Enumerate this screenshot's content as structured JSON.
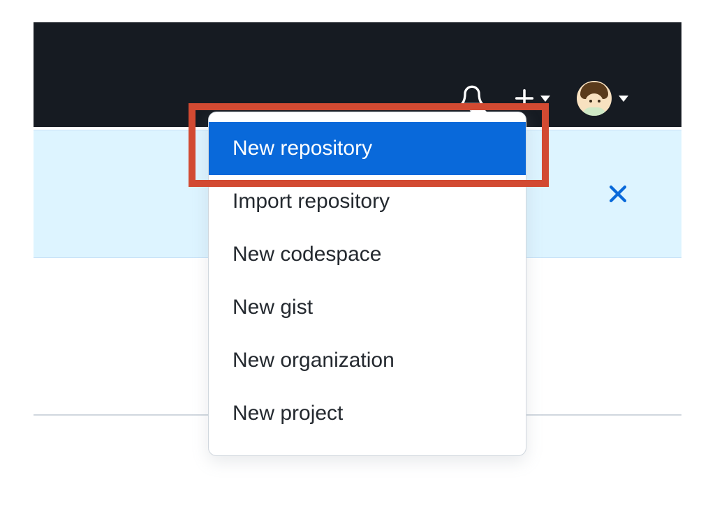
{
  "header": {
    "notification_label": "Notifications",
    "create_label": "Create new…",
    "user_label": "User menu"
  },
  "dropdown": {
    "items": [
      {
        "label": "New repository",
        "active": true
      },
      {
        "label": "Import repository",
        "active": false
      },
      {
        "label": "New codespace",
        "active": false
      },
      {
        "label": "New gist",
        "active": false
      },
      {
        "label": "New organization",
        "active": false
      },
      {
        "label": "New project",
        "active": false
      }
    ]
  },
  "banner": {
    "dismiss_label": "Dismiss"
  },
  "colors": {
    "highlight": "#d24a32",
    "accent": "#0969da",
    "header_bg": "#161b22",
    "banner_bg": "#ddf4ff"
  }
}
